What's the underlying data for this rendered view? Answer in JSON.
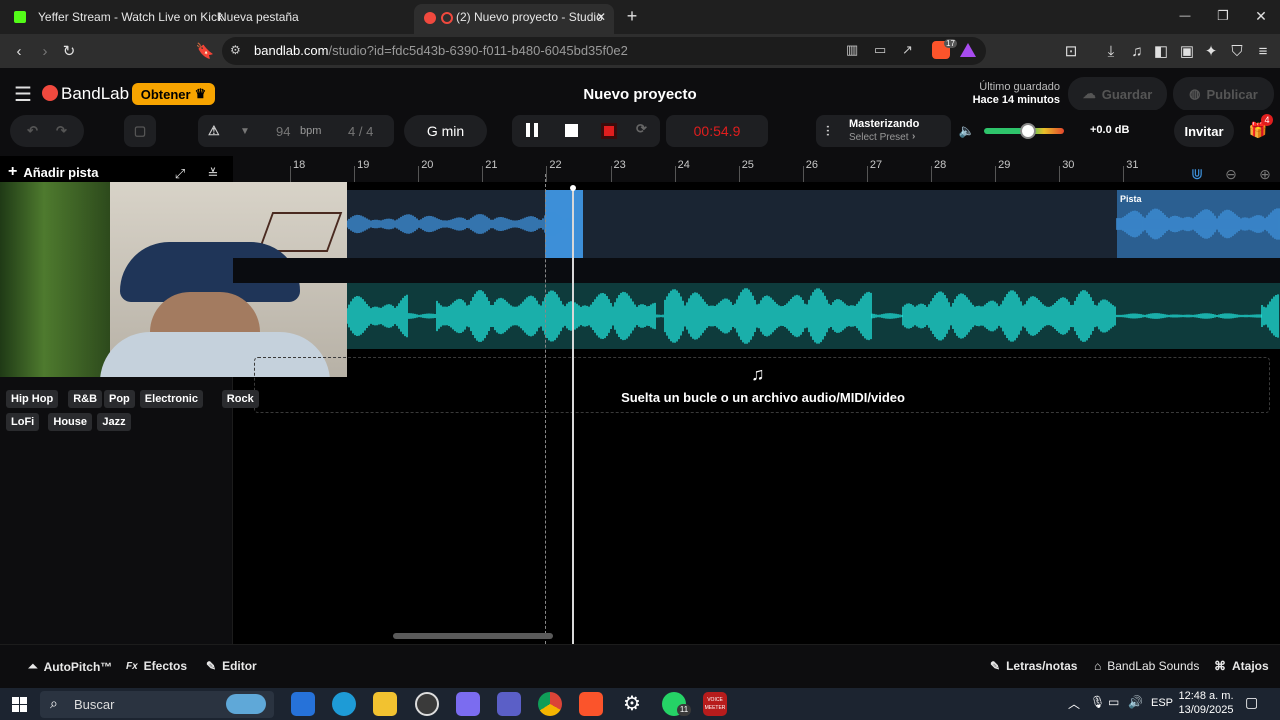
{
  "browser": {
    "tabs": [
      {
        "title": "Yeffer Stream - Watch Live on Kick"
      },
      {
        "title": "Nueva pestaña"
      },
      {
        "title": "(2) Nuevo proyecto - Studio"
      }
    ],
    "new_tab_symbol": "+",
    "url_host": "bandlab.com",
    "url_path": "/studio?id=fdc5d43b-6390-f011-b480-6045bd35f0e2",
    "brave_shield_count": "17",
    "window_controls": {
      "minimize": "—",
      "restore": "❐",
      "close": "✕"
    }
  },
  "app": {
    "logo": "BandLab",
    "obtener_label": "Obtener",
    "project_title": "Nuevo proyecto",
    "last_saved_label": "Último guardado",
    "last_saved_time": "Hace 14 minutos",
    "save_label": "Guardar",
    "publish_label": "Publicar",
    "invite_label": "Invitar",
    "gift_badge": "4"
  },
  "toolbar": {
    "tempo": "94",
    "tempo_unit": "bpm",
    "time_signature": "4 / 4",
    "key": "G min",
    "time_display": "00:54.9",
    "mastering_title": "Masterizando",
    "mastering_preset": "Select Preset",
    "volume_db": "+0.0 dB",
    "volume_level": 0.55
  },
  "tracks_panel": {
    "add_track_label": "Añadir pista",
    "genres_row1": [
      "Hip Hop",
      "R&B",
      "Pop",
      "Electronic",
      "Rock"
    ],
    "genres_row2": [
      "LoFi",
      "House",
      "Jazz"
    ]
  },
  "ruler": {
    "bars": [
      "18",
      "19",
      "20",
      "21",
      "22",
      "23",
      "24",
      "25",
      "26",
      "27",
      "28",
      "29",
      "30",
      "31"
    ]
  },
  "timeline": {
    "clip_label": "Pista",
    "drop_text": "Suelta un bucle o un archivo audio/MIDI/video"
  },
  "bottom": {
    "autopitch": "AutoPitch™",
    "effects": "Efectos",
    "editor": "Editor",
    "lyrics": "Letras/notas",
    "sounds": "BandLab Sounds",
    "shortcuts": "Atajos"
  },
  "taskbar": {
    "search_placeholder": "Buscar",
    "whatsapp_badge": "11",
    "voicemeeter_label": "VOICE\nMEETER",
    "language": "ESP",
    "time": "12:48 a. m.",
    "date": "13/09/2025"
  },
  "colors": {
    "accent_orange": "#f7a400",
    "record_red": "#e01e1e",
    "track1_blue": "#3d8fd8",
    "track2_cyan": "#1ed6cf",
    "bandlab_red": "#f0493e"
  }
}
